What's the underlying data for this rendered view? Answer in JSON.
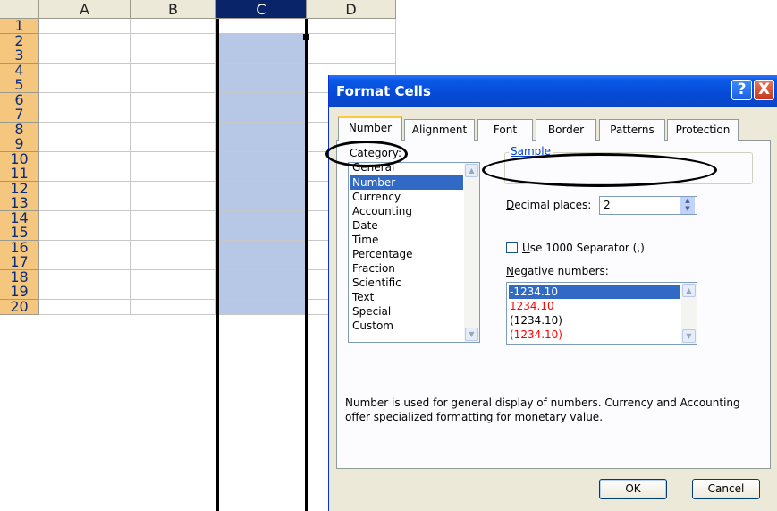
{
  "sheet": {
    "columns": [
      "A",
      "B",
      "C",
      "D"
    ],
    "rows": [
      "1",
      "2",
      "3",
      "4",
      "5",
      "6",
      "7",
      "8",
      "9",
      "10",
      "11",
      "12",
      "13",
      "14",
      "15",
      "16",
      "17",
      "18",
      "19",
      "20"
    ],
    "selected_column": "C"
  },
  "dialog": {
    "title": "Format Cells",
    "help_symbol": "?",
    "close_symbol": "X",
    "tabs": [
      "Number",
      "Alignment",
      "Font",
      "Border",
      "Patterns",
      "Protection"
    ],
    "active_tab": "Number",
    "category": {
      "label_hotkey": "C",
      "label_rest": "ategory:",
      "items": [
        "General",
        "Number",
        "Currency",
        "Accounting",
        "Date",
        "Time",
        "Percentage",
        "Fraction",
        "Scientific",
        "Text",
        "Special",
        "Custom"
      ],
      "selected": "Number"
    },
    "sample": {
      "label": "Sample",
      "value": ""
    },
    "decimal": {
      "label_hotkey": "D",
      "label_rest": "ecimal places:",
      "value": "2"
    },
    "separator": {
      "label_hotkey": "U",
      "label_rest": "se 1000 Separator (,)",
      "checked": false
    },
    "negative": {
      "label_hotkey": "N",
      "label_rest": "egative numbers:",
      "items": [
        {
          "text": "-1234.10",
          "color": "#000000",
          "selected": true
        },
        {
          "text": "1234.10",
          "color": "#ff0000",
          "selected": false
        },
        {
          "text": "(1234.10)",
          "color": "#000000",
          "selected": false
        },
        {
          "text": "(1234.10)",
          "color": "#ff0000",
          "selected": false
        }
      ]
    },
    "description": "Number is used for general display of numbers.  Currency and Accounting offer specialized formatting for monetary value.",
    "ok_label": "OK",
    "cancel_label": "Cancel"
  }
}
